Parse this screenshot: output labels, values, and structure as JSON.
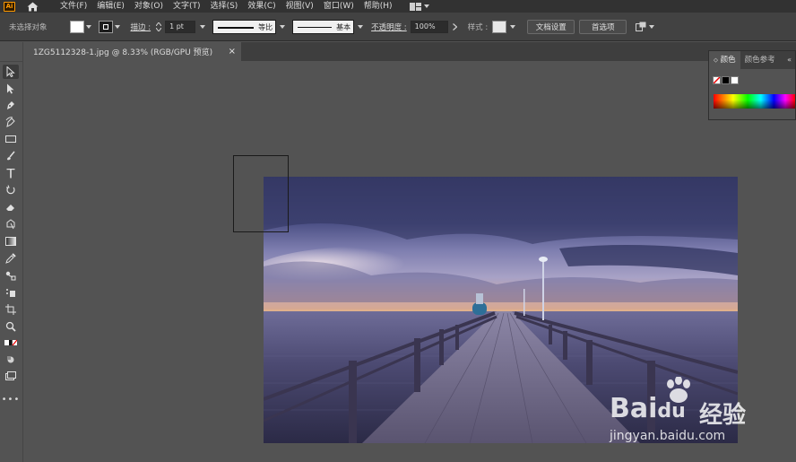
{
  "app": {
    "logo_text": "Ai"
  },
  "menu": {
    "items": [
      "文件(F)",
      "编辑(E)",
      "对象(O)",
      "文字(T)",
      "选择(S)",
      "效果(C)",
      "视图(V)",
      "窗口(W)",
      "帮助(H)"
    ]
  },
  "control_bar": {
    "selection_status": "未选择对象",
    "stroke_label": "描边 :",
    "stroke_weight": "1 pt",
    "profile_label": "等比",
    "brush_label": "基本",
    "opacity_label": "不透明度 :",
    "opacity_value": "100%",
    "style_label": "样式 :",
    "doc_setup_button": "文档设置",
    "preferences_button": "首选项",
    "fill_color": "#ffffff",
    "stroke_color": "#000000"
  },
  "document": {
    "tab_title": "1ZG5112328-1.jpg @ 8.33% (RGB/GPU 预览)",
    "tab_close": "×"
  },
  "color_panel": {
    "tabs": [
      "颜色",
      "颜色参考"
    ],
    "menu_glyph": "«"
  },
  "watermark": {
    "brand": "Bai",
    "brand_suffix": "du",
    "cn_text": "经验",
    "url": "jingyan.baidu.com"
  },
  "icons": {
    "home": "home-icon",
    "workspace": "workspace-grid-icon",
    "arrange": "arrange-documents-icon"
  }
}
